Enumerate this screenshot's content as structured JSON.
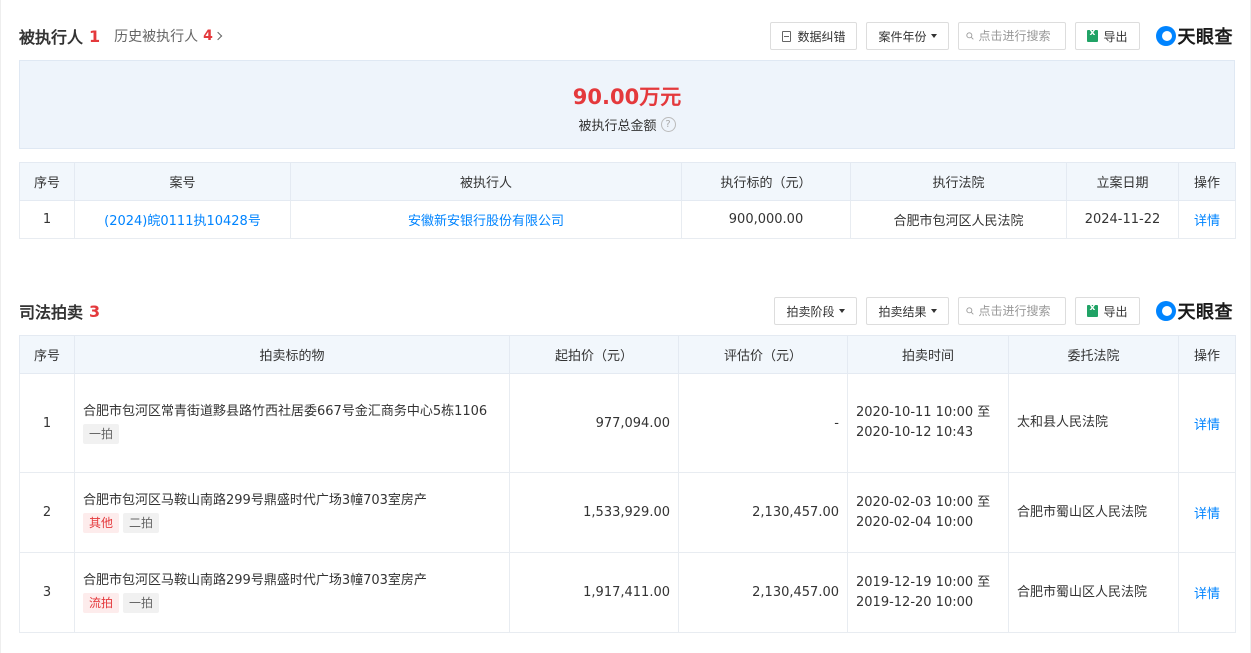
{
  "section1": {
    "title": "被执行人",
    "count": "1",
    "history_label": "历史被执行人",
    "history_count": "4",
    "toolbar": {
      "correct_label": "数据纠错",
      "year_label": "案件年份",
      "search_placeholder": "点击进行搜索",
      "export_label": "导出"
    },
    "logo_text": "天眼查",
    "summary": {
      "amount": "90.00万元",
      "label": "被执行总金额"
    },
    "table": {
      "headers": [
        "序号",
        "案号",
        "被执行人",
        "执行标的（元）",
        "执行法院",
        "立案日期",
        "操作"
      ],
      "rows": [
        {
          "no": "1",
          "case_no": "(2024)皖0111执10428号",
          "party": "安徽新安银行股份有限公司",
          "amount": "900,000.00",
          "court": "合肥市包河区人民法院",
          "date": "2024-11-22",
          "action": "详情"
        }
      ]
    }
  },
  "section2": {
    "title": "司法拍卖",
    "count": "3",
    "toolbar": {
      "stage_label": "拍卖阶段",
      "result_label": "拍卖结果",
      "search_placeholder": "点击进行搜索",
      "export_label": "导出"
    },
    "logo_text": "天眼查",
    "table": {
      "headers": [
        "序号",
        "拍卖标的物",
        "起拍价（元）",
        "评估价（元）",
        "拍卖时间",
        "委托法院",
        "操作"
      ],
      "rows": [
        {
          "no": "1",
          "item": "合肥市包河区常青街道黟县路竹西社居委667号金汇商务中心5栋1106",
          "tags": [
            {
              "text": "一拍",
              "style": "gray"
            }
          ],
          "start_price": "977,094.00",
          "appraisal": "-",
          "time": "2020-10-11 10:00 至 2020-10-12 10:43",
          "court": "太和县人民法院",
          "action": "详情"
        },
        {
          "no": "2",
          "item": "合肥市包河区马鞍山南路299号鼎盛时代广场3幢703室房产",
          "tags": [
            {
              "text": "其他",
              "style": "red"
            },
            {
              "text": "二拍",
              "style": "gray"
            }
          ],
          "start_price": "1,533,929.00",
          "appraisal": "2,130,457.00",
          "time": "2020-02-03 10:00 至 2020-02-04 10:00",
          "court": "合肥市蜀山区人民法院",
          "action": "详情"
        },
        {
          "no": "3",
          "item": "合肥市包河区马鞍山南路299号鼎盛时代广场3幢703室房产",
          "tags": [
            {
              "text": "流拍",
              "style": "red"
            },
            {
              "text": "一拍",
              "style": "gray"
            }
          ],
          "start_price": "1,917,411.00",
          "appraisal": "2,130,457.00",
          "time": "2019-12-19 10:00 至 2019-12-20 10:00",
          "court": "合肥市蜀山区人民法院",
          "action": "详情"
        }
      ]
    }
  }
}
